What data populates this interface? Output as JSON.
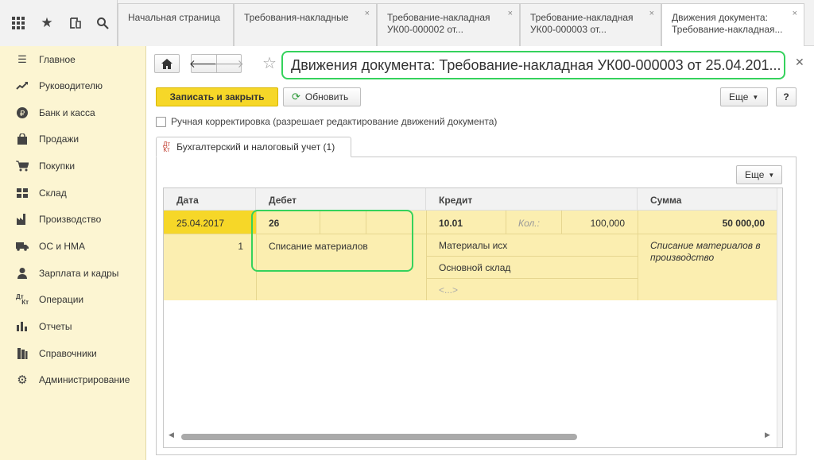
{
  "topbar": {
    "icons": [
      "apps-grid-icon",
      "star-icon",
      "history-icon",
      "search-icon"
    ],
    "tabs": [
      {
        "line1": "Начальная страница",
        "line2": "",
        "closable": false,
        "active": false
      },
      {
        "line1": "Требования-накладные",
        "line2": "",
        "closable": true,
        "active": false
      },
      {
        "line1": "Требование-накладная",
        "line2": "УК00-000002 от...",
        "closable": true,
        "active": false
      },
      {
        "line1": "Требование-накладная",
        "line2": "УК00-000003 от...",
        "closable": true,
        "active": false
      },
      {
        "line1": "Движения документа:",
        "line2": "Требование-накладная...",
        "closable": true,
        "active": true
      }
    ]
  },
  "sidebar": {
    "items": [
      {
        "label": "Главное",
        "icon": "menu-lines-icon"
      },
      {
        "label": "Руководителю",
        "icon": "trend-chart-icon"
      },
      {
        "label": "Банк и касса",
        "icon": "ruble-coin-icon"
      },
      {
        "label": "Продажи",
        "icon": "shopping-bag-icon"
      },
      {
        "label": "Покупки",
        "icon": "shopping-cart-icon"
      },
      {
        "label": "Склад",
        "icon": "warehouse-icon"
      },
      {
        "label": "Производство",
        "icon": "factory-icon"
      },
      {
        "label": "ОС и НМА",
        "icon": "truck-icon"
      },
      {
        "label": "Зарплата и кадры",
        "icon": "person-icon"
      },
      {
        "label": "Операции",
        "icon": "debit-credit-icon"
      },
      {
        "label": "Отчеты",
        "icon": "bar-chart-icon"
      },
      {
        "label": "Справочники",
        "icon": "books-icon"
      },
      {
        "label": "Администрирование",
        "icon": "gear-icon"
      }
    ]
  },
  "document": {
    "title": "Движения документа: Требование-накладная УК00-000003 от 25.04.201...",
    "save_close_label": "Записать и закрыть",
    "refresh_label": "Обновить",
    "more_label": "Еще",
    "help_label": "?",
    "manual_label": "Ручная корректировка (разрешает редактирование движений документа)",
    "tab_label": "Бухгалтерский и налоговый учет (1)",
    "tab_icon_top": "Дт",
    "tab_icon_bottom": "Кт",
    "table_more_label": "Еще"
  },
  "table": {
    "headers": [
      "Дата",
      "Дебет",
      "Кредит",
      "Сумма"
    ],
    "row": {
      "date": "25.04.2017",
      "number": "1",
      "debit_account": "26",
      "debit_sub1": "Списание материалов",
      "credit_account": "10.01",
      "credit_qty_label": "Кол.:",
      "credit_qty": "100,000",
      "credit_sub1": "Материалы исх",
      "credit_sub2": "Основной склад",
      "credit_sub3": "<...>",
      "amount": "50 000,00",
      "description": "Списание материалов в производство"
    }
  },
  "colors": {
    "sidebar_bg": "#fcf5d2",
    "accent_yellow": "#f6d728",
    "row_highlight": "#fbeeb0",
    "annotation_green": "#35d25c"
  }
}
